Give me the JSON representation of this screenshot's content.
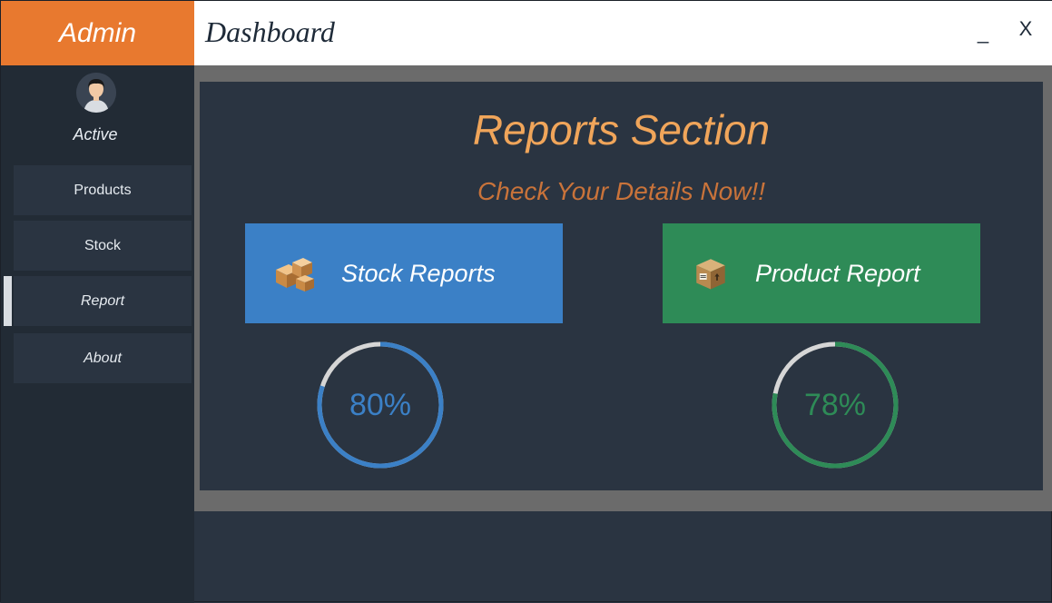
{
  "sidebar": {
    "brand": "Admin",
    "user_status": "Active",
    "items": [
      {
        "label": "Products"
      },
      {
        "label": "Stock"
      },
      {
        "label": "Report"
      },
      {
        "label": "About"
      }
    ]
  },
  "header": {
    "title": "Dashboard",
    "minimize_label": "_",
    "close_label": "X"
  },
  "reports": {
    "title": "Reports Section",
    "subtitle": "Check Your Details Now!!",
    "stock": {
      "label": "Stock Reports",
      "icon": "boxes-icon",
      "color": "#3b80c6"
    },
    "product": {
      "label": "Product Report",
      "icon": "package-crate-icon",
      "color": "#2e8b57"
    }
  },
  "gauges": {
    "stock": {
      "text": "80%",
      "value": 80,
      "color": "#3b80c6"
    },
    "product": {
      "text": "78%",
      "value": 78,
      "color": "#2e8b57"
    }
  },
  "colors": {
    "brand": "#e8792f",
    "sidebar": "#222b35",
    "panel": "#2a3441",
    "title": "#f0a55a",
    "subtitle": "#c9733a"
  }
}
